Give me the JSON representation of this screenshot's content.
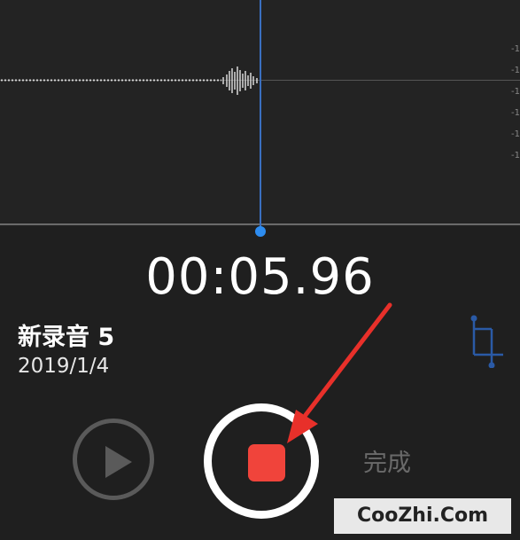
{
  "recording": {
    "elapsed": "00:05.96",
    "name": "新录音 5",
    "date": "2019/1/4"
  },
  "controls": {
    "done_label": "完成"
  },
  "axis_ticks": [
    "-1",
    "-1",
    "-1",
    "-1",
    "-1",
    "-1"
  ],
  "watermark": "CooZhi.Com",
  "colors": {
    "record_red": "#f0443b",
    "playhead_blue": "#2d8cf0",
    "annotation_red": "#e8302a"
  },
  "icons": {
    "play": "play-icon",
    "stop": "stop-icon",
    "trim": "trim-icon"
  }
}
